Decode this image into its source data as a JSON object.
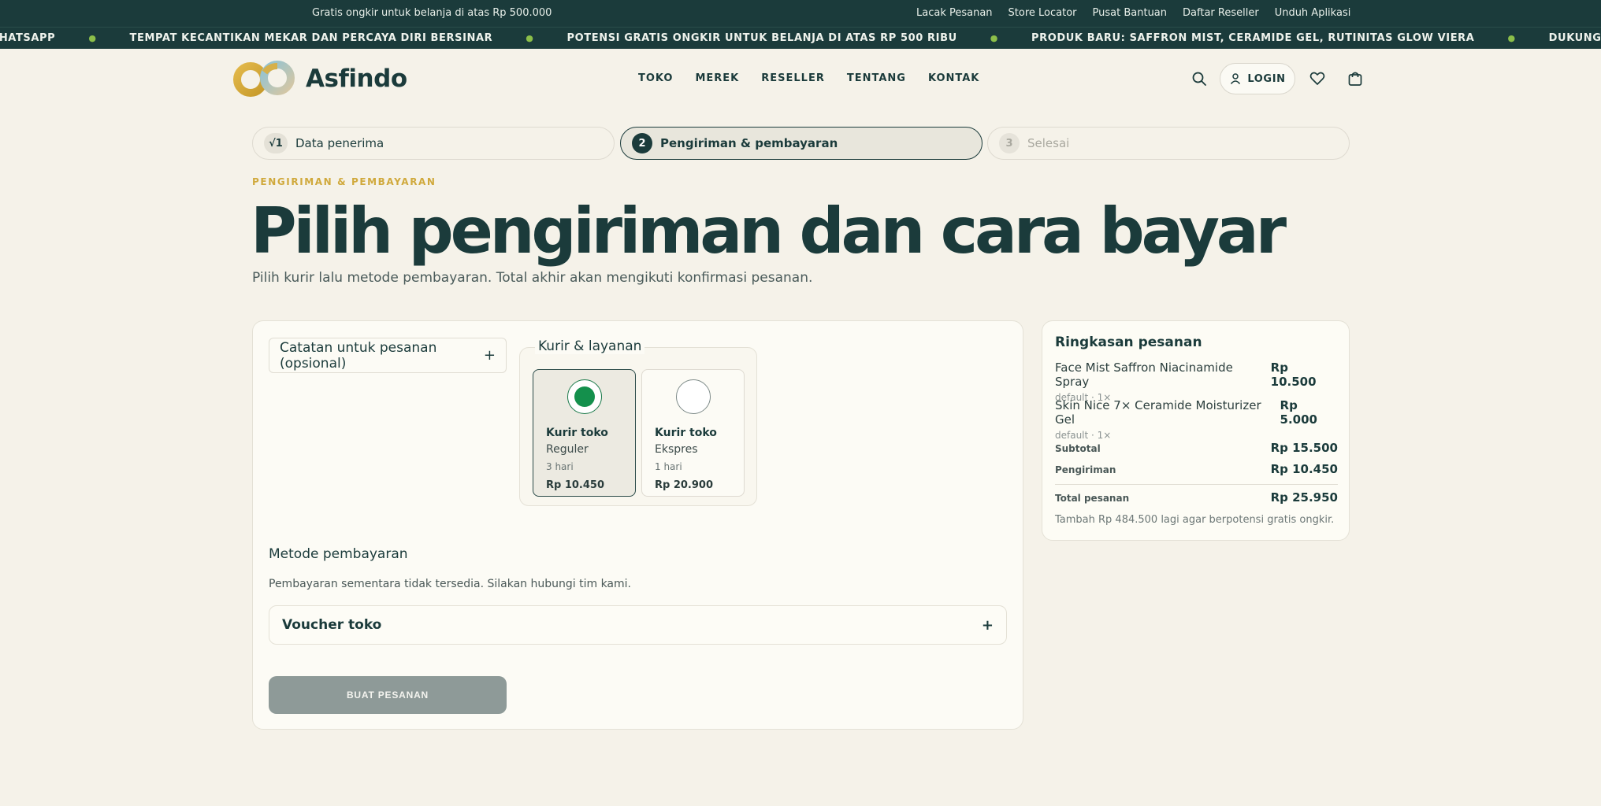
{
  "topbar": {
    "promo": "Gratis ongkir untuk belanja di atas Rp 500.000",
    "links": [
      "Lacak Pesanan",
      "Store Locator",
      "Pusat Bantuan",
      "Daftar Reseller",
      "Unduh Aplikasi"
    ]
  },
  "ticker": {
    "items": [
      "VIA WHATSAPP",
      "TEMPAT KECANTIKAN MEKAR DAN PERCAYA DIRI BERSINAR",
      "POTENSI GRATIS ONGKIR UNTUK BELANJA DI ATAS RP 500 RIBU",
      "PRODUK BARU: SAFFRON MIST, CERAMIDE GEL, RUTINITAS GLOW VIERA",
      "DUKUNGAN PESANAN VI VIA WHATSAPP"
    ],
    "separator": "●"
  },
  "header": {
    "brand": "Asfindo",
    "nav": [
      "TOKO",
      "MEREK",
      "RESELLER",
      "TENTANG",
      "KONTAK"
    ],
    "login_label": "LOGIN",
    "icons": [
      "search-icon",
      "user-icon",
      "heart-icon",
      "cart-icon"
    ]
  },
  "steps": [
    {
      "num": "√1",
      "label": "Data penerima",
      "state": "done"
    },
    {
      "num": "2",
      "label": "Pengiriman & pembayaran",
      "state": "active"
    },
    {
      "num": "3",
      "label": "Selesai",
      "state": "pending"
    }
  ],
  "page": {
    "eyebrow": "PENGIRIMAN & PEMBAYARAN",
    "title": "Pilih pengiriman dan cara bayar",
    "subtitle": "Pilih kurir lalu metode pembayaran. Total akhir akan mengikuti konfirmasi pesanan."
  },
  "form": {
    "notes_label": "Catatan untuk pesanan (opsional)",
    "expand_symbol": "+",
    "courier_legend": "Kurir & layanan",
    "couriers": [
      {
        "name": "Kurir toko",
        "service": "Reguler",
        "eta": "3 hari",
        "price": "Rp 10.450",
        "selected": true
      },
      {
        "name": "Kurir toko",
        "service": "Ekspres",
        "eta": "1 hari",
        "price": "Rp 20.900",
        "selected": false
      }
    ],
    "payment_title": "Metode pembayaran",
    "payment_note": "Pembayaran sementara tidak tersedia. Silakan hubungi tim kami.",
    "voucher_label": "Voucher toko",
    "submit_label": "BUAT PESANAN"
  },
  "summary": {
    "title": "Ringkasan pesanan",
    "items": [
      {
        "name": "Face Mist Saffron Niacinamide Spray",
        "meta": "default · 1×",
        "price": "Rp 10.500"
      },
      {
        "name": "Skin Nice 7× Ceramide Moisturizer Gel",
        "meta": "default · 1×",
        "price": "Rp 5.000"
      }
    ],
    "subtotal_label": "Subtotal",
    "subtotal": "Rp 15.500",
    "shipping_label": "Pengiriman",
    "shipping": "Rp 10.450",
    "total_label": "Total pesanan",
    "total": "Rp 25.950",
    "hint": "Tambah Rp 484.500 lagi agar berpotensi gratis ongkir."
  },
  "colors": {
    "dark": "#1b3b3b",
    "cream": "#f5f2e9",
    "gold": "#d0a93c",
    "radio_green": "#14904c",
    "disabled_button": "#8e9a98"
  }
}
